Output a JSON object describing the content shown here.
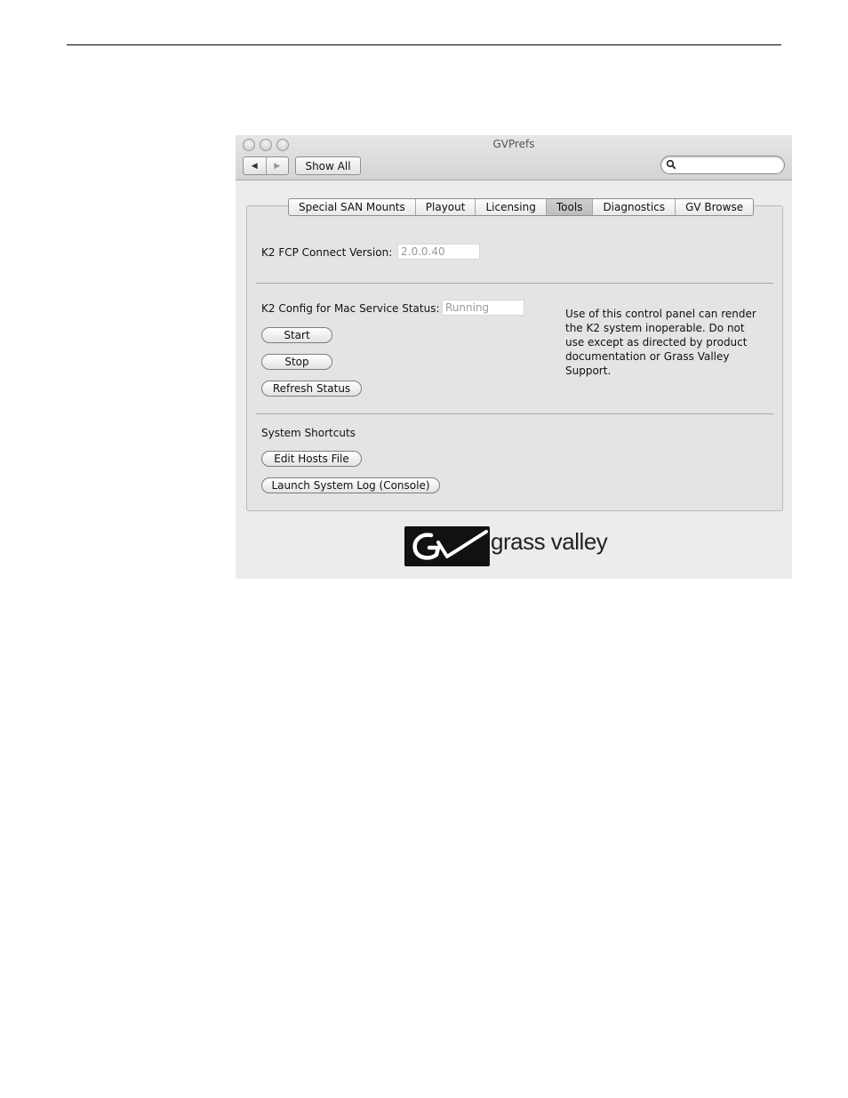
{
  "window": {
    "title": "GVPrefs",
    "nav": {
      "back_icon": "◀",
      "forward_icon": "▶"
    },
    "show_all_label": "Show All",
    "search": {
      "placeholder": "",
      "value": ""
    }
  },
  "tabs": [
    {
      "label": "Special SAN Mounts",
      "active": false
    },
    {
      "label": "Playout",
      "active": false
    },
    {
      "label": "Licensing",
      "active": false
    },
    {
      "label": "Tools",
      "active": true
    },
    {
      "label": "Diagnostics",
      "active": false
    },
    {
      "label": "GV Browse",
      "active": false
    }
  ],
  "tools": {
    "fcp_version_label": "K2 FCP Connect Version:",
    "fcp_version_value": "2.0.0.40",
    "service_status_label": "K2 Config for Mac Service Status:",
    "service_status_value": "Running",
    "start_label": "Start",
    "stop_label": "Stop",
    "refresh_label": "Refresh Status",
    "warning_text": "Use of this control panel can render the K2 system inoperable. Do not use except as directed by product documentation or Grass Valley Support.",
    "shortcuts_heading": "System Shortcuts",
    "edit_hosts_label": "Edit Hosts File",
    "launch_log_label": "Launch System Log (Console)"
  },
  "logo": {
    "text": "grass valley"
  }
}
